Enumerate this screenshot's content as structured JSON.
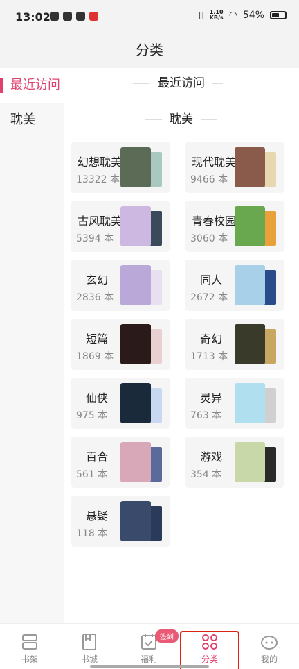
{
  "status_bar": {
    "time": "13:02",
    "speed_value": "1.10",
    "speed_unit": "KB/s",
    "battery": "54%"
  },
  "header": {
    "title": "分类"
  },
  "sidebar": {
    "items": [
      {
        "label": "最近访问"
      },
      {
        "label": "耽美"
      }
    ]
  },
  "main": {
    "section_recent": "最近访问",
    "section_category": "耽美",
    "categories": [
      {
        "name": "幻想耽美",
        "count": "13322 本",
        "cover_color": "#5c6b55",
        "side_color": "#a8c8c0"
      },
      {
        "name": "现代耽美",
        "count": "9466 本",
        "cover_color": "#8a5a4a",
        "side_color": "#e8d8b0"
      },
      {
        "name": "古风耽美",
        "count": "5394 本",
        "cover_color": "#cdb8e2",
        "side_color": "#3a4a5a"
      },
      {
        "name": "青春校园",
        "count": "3060 本",
        "cover_color": "#6aa84f",
        "side_color": "#e9a23b"
      },
      {
        "name": "玄幻",
        "count": "2836 本",
        "cover_color": "#b9a8d8",
        "side_color": "#e8e0f0"
      },
      {
        "name": "同人",
        "count": "2672 本",
        "cover_color": "#a8d0e8",
        "side_color": "#2a4a8a"
      },
      {
        "name": "短篇",
        "count": "1869 本",
        "cover_color": "#2a1a1a",
        "side_color": "#e8d0d0"
      },
      {
        "name": "奇幻",
        "count": "1713 本",
        "cover_color": "#3a3a2a",
        "side_color": "#c8a860"
      },
      {
        "name": "仙侠",
        "count": "975 本",
        "cover_color": "#1a2a3a",
        "side_color": "#c8d8f0"
      },
      {
        "name": "灵异",
        "count": "763 本",
        "cover_color": "#b0e0f0",
        "side_color": "#d0d0d0"
      },
      {
        "name": "百合",
        "count": "561 本",
        "cover_color": "#d8a8b8",
        "side_color": "#5a6a9a"
      },
      {
        "name": "游戏",
        "count": "354 本",
        "cover_color": "#c8d8a8",
        "side_color": "#2a2a2a"
      },
      {
        "name": "悬疑",
        "count": "118 本",
        "cover_color": "#3a4a6a",
        "side_color": "#2a3a5a"
      }
    ]
  },
  "tab_bar": {
    "tabs": [
      {
        "label": "书架"
      },
      {
        "label": "书城"
      },
      {
        "label": "福利"
      },
      {
        "label": "分类"
      },
      {
        "label": "我的"
      }
    ],
    "badge": "签到"
  }
}
